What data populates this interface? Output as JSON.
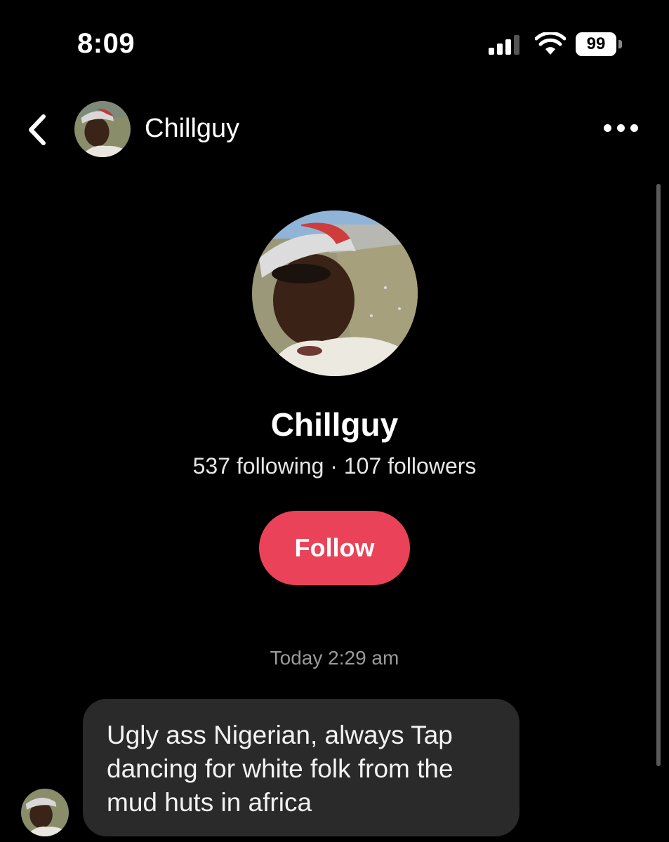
{
  "status_bar": {
    "time": "8:09",
    "battery_level": "99",
    "signal_icon": "cellular-signal-icon",
    "wifi_icon": "wifi-icon"
  },
  "header": {
    "back_icon": "chevron-left-icon",
    "username": "Chillguy",
    "more_icon": "more-horizontal-icon"
  },
  "profile": {
    "name": "Chillguy",
    "stats": "537 following · 107 followers",
    "follow_label": "Follow"
  },
  "conversation": {
    "timestamp": "Today 2:29 am",
    "messages": [
      {
        "text": "Ugly ass Nigerian, always Tap dancing for white folk from the mud huts in africa"
      }
    ]
  },
  "colors": {
    "background": "#000000",
    "follow_button": "#ea4359",
    "bubble": "#2a2a2a",
    "timestamp_text": "#9a9a9a"
  }
}
